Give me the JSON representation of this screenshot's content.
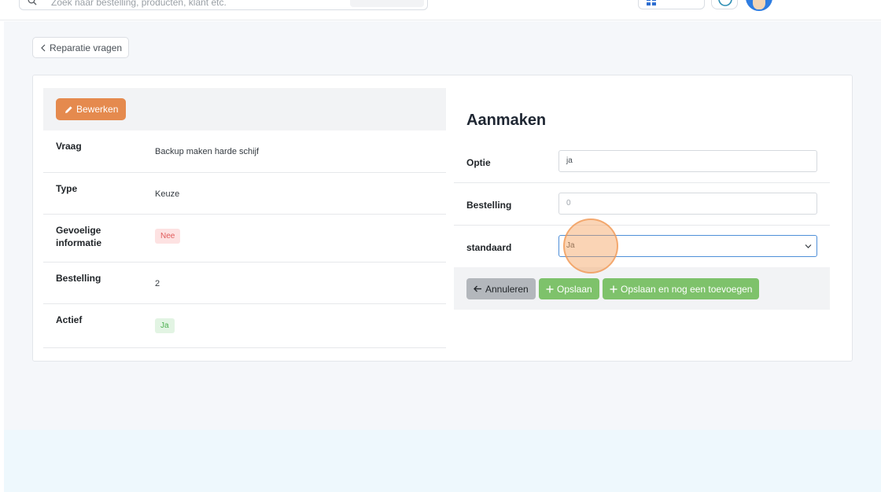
{
  "header": {
    "search_placeholder": "Zoek naar bestelling, producten, klant etc.",
    "search_text": ""
  },
  "back_button": {
    "label": "Reparatie vragen"
  },
  "details": {
    "edit_label": "Bewerken",
    "rows": [
      {
        "label": "Vraag",
        "value": "Backup maken harde schijf"
      },
      {
        "label": "Type",
        "value": "Keuze"
      },
      {
        "label": "Gevoelige informatie",
        "value": "Nee"
      },
      {
        "label": "Bestelling",
        "value": "2"
      },
      {
        "label": "Actief",
        "value": "Ja"
      }
    ]
  },
  "form": {
    "title": "Aanmaken",
    "fields": [
      {
        "label": "Optie",
        "value": "ja"
      },
      {
        "label": "Bestelling",
        "value": "",
        "placeholder": "0"
      },
      {
        "label": "standaard",
        "selected": "Ja"
      }
    ],
    "actions": {
      "cancel_label": "Annuleren",
      "save_label": "Opslaan",
      "save_add_label": "Opslaan en nog een toevoegen"
    }
  },
  "colors": {
    "edit_button": "#e58a4e",
    "save_button": "#7ec26b",
    "cancel_button": "#b3b7bc",
    "badge_no_text": "#e05b5b",
    "badge_yes_text": "#4caf50",
    "focus_border": "#4e8fd8"
  },
  "icons": {
    "search": "search-icon",
    "apps": "apps-icon",
    "help": "help-icon",
    "back": "chevron-left-icon",
    "edit": "pencil-icon",
    "select": "chevron-down-icon",
    "cancel": "arrow-left-icon",
    "save": "plus-icon"
  }
}
